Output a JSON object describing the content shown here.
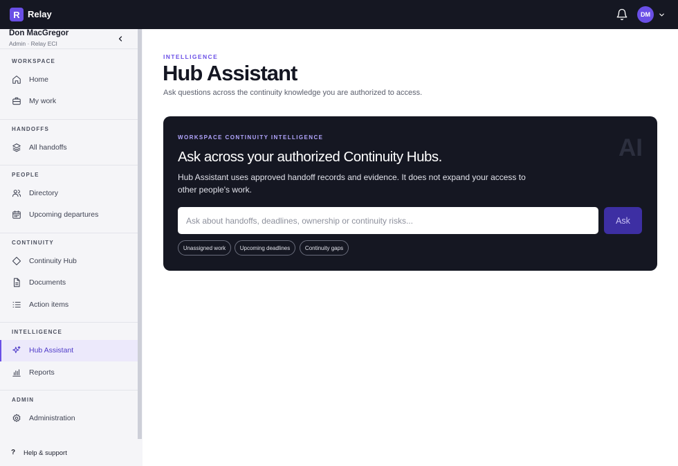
{
  "app": {
    "logo_letter": "R",
    "name": "Relay"
  },
  "header": {
    "avatar_initials": "DM",
    "icons": [
      "bell-icon",
      "chevron-down-icon"
    ]
  },
  "user": {
    "name": "Don MacGregor",
    "role": "Admin · Relay ECI"
  },
  "sidebar": {
    "sections": [
      {
        "label": "WORKSPACE",
        "items": [
          {
            "label": "Home",
            "icon": "home-icon"
          },
          {
            "label": "My work",
            "icon": "briefcase-icon"
          }
        ]
      },
      {
        "label": "HANDOFFS",
        "items": [
          {
            "label": "All handoffs",
            "icon": "layers-icon"
          }
        ]
      },
      {
        "label": "PEOPLE",
        "items": [
          {
            "label": "Directory",
            "icon": "users-icon"
          },
          {
            "label": "Upcoming departures",
            "icon": "calendar-icon"
          }
        ]
      },
      {
        "label": "CONTINUITY",
        "items": [
          {
            "label": "Continuity Hub",
            "icon": "diamond-icon"
          },
          {
            "label": "Documents",
            "icon": "document-icon"
          },
          {
            "label": "Action items",
            "icon": "list-icon"
          }
        ]
      },
      {
        "label": "INTELLIGENCE",
        "items": [
          {
            "label": "Hub Assistant",
            "icon": "sparkle-icon",
            "active": true
          },
          {
            "label": "Reports",
            "icon": "bar-chart-icon"
          }
        ]
      },
      {
        "label": "ADMIN",
        "items": [
          {
            "label": "Administration",
            "icon": "gear-icon"
          }
        ]
      }
    ],
    "help": {
      "glyph": "?",
      "label": "Help & support"
    }
  },
  "main": {
    "eyebrow": "INTELLIGENCE",
    "title": "Hub Assistant",
    "subtitle": "Ask questions across the continuity knowledge you are authorized to access."
  },
  "card": {
    "eyebrow": "WORKSPACE CONTINUITY INTELLIGENCE",
    "title": "Ask across your authorized Continuity Hubs.",
    "description": "Hub Assistant uses approved handoff records and evidence. It does not expand your access to other people's work.",
    "watermark": "AI",
    "input_placeholder": "Ask about handoffs, deadlines, ownership or continuity risks...",
    "input_value": "",
    "ask_label": "Ask",
    "chips": [
      "Unassigned work",
      "Upcoming deadlines",
      "Continuity gaps"
    ]
  },
  "colors": {
    "accent": "#6a4fe6",
    "topbar": "#151722",
    "card": "#151722",
    "ask_button": "#3d2fa3"
  }
}
